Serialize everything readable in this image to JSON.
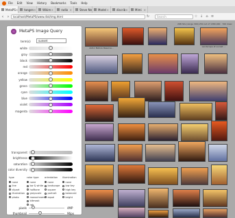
{
  "menubar": {
    "items": [
      "File",
      "Edit",
      "View",
      "History",
      "Bookmarks",
      "Tools",
      "Help"
    ]
  },
  "tabs": [
    {
      "label": "MetaPS",
      "active": true
    },
    {
      "label": "tangen",
      "active": false
    },
    {
      "label": "Wikim",
      "active": false
    },
    {
      "label": "radio",
      "active": false
    },
    {
      "label": "Steve Net",
      "active": false
    },
    {
      "label": "Model",
      "active": false
    },
    {
      "label": "discrib",
      "active": false
    },
    {
      "label": "Mimi",
      "active": false
    }
  ],
  "urlbar": {
    "url": "localhost/MetaPS/www.dist/img.html",
    "search_placeholder": "Search"
  },
  "info_text": "268 hits (range 300) 250 out of 1380,000 · 700 msec",
  "panel": {
    "title_main": "MetaPS",
    "title_sub": " Image Query",
    "term_label": "term(s)",
    "term_value": "sunset",
    "sliders": [
      {
        "label": "white",
        "gradient": "linear-gradient(90deg,#ddd,#fff)",
        "knob": 0.5
      },
      {
        "label": "gray",
        "gradient": "linear-gradient(90deg,#ddd,#777)",
        "knob": 0.5
      },
      {
        "label": "black",
        "gradient": "linear-gradient(90deg,#ddd,#000)",
        "knob": 0.5
      },
      {
        "label": "red",
        "gradient": "linear-gradient(90deg,#ddd,#f00)",
        "knob": 0.5
      },
      {
        "label": "orange",
        "gradient": "linear-gradient(90deg,#ddd,#ff8c00)",
        "knob": 0.5
      },
      {
        "label": "yellow",
        "gradient": "linear-gradient(90deg,#ddd,#ff0)",
        "knob": 0.5
      },
      {
        "label": "green",
        "gradient": "linear-gradient(90deg,#ddd,#0f0)",
        "knob": 0.5
      },
      {
        "label": "cyan",
        "gradient": "linear-gradient(90deg,#ddd,#0ff)",
        "knob": 0.5
      },
      {
        "label": "blue",
        "gradient": "linear-gradient(90deg,#ddd,#00f)",
        "knob": 0.5
      },
      {
        "label": "violet",
        "gradient": "linear-gradient(90deg,#ddd,#a0f)",
        "knob": 0.5
      },
      {
        "label": "magenta",
        "gradient": "linear-gradient(90deg,#ddd,#f0f)",
        "knob": 0.5
      },
      {
        "label": "transparent",
        "gradient": "linear-gradient(90deg,#ddd,#bbb)",
        "knob": 0.05
      },
      {
        "label": "brightness",
        "gradient": "linear-gradient(90deg,#000,#fff)",
        "knob": 0.05
      },
      {
        "label": "saturation",
        "gradient": "linear-gradient(90deg,#ddd,#000)",
        "knob": 0.05
      },
      {
        "label": "color diversity",
        "gradient": "linear-gradient(90deg,#ddd,#000)",
        "knob": 0.05
      }
    ],
    "options": [
      {
        "head": "type",
        "items": [
          {
            "t": "none",
            "on": true
          },
          {
            "t": "line",
            "on": false
          },
          {
            "t": "clipart",
            "on": false
          },
          {
            "t": "illustration",
            "on": false
          },
          {
            "t": "photo",
            "on": false
          }
        ]
      },
      {
        "head": "color type",
        "items": [
          {
            "t": "none",
            "on": true
          },
          {
            "t": "bw & white",
            "on": false
          },
          {
            "t": "halftone",
            "on": false
          },
          {
            "t": "grayscale",
            "on": false
          },
          {
            "t": "monochrome",
            "on": false
          },
          {
            "t": "bitmask",
            "on": false
          },
          {
            "t": "rgb",
            "on": false
          }
        ]
      },
      {
        "head": "orientation",
        "items": [
          {
            "t": "none",
            "on": true
          },
          {
            "t": "landscape",
            "on": false
          },
          {
            "t": "square",
            "on": false
          },
          {
            "t": "portrait",
            "on": false
          },
          {
            "t": "equal",
            "on": false
          }
        ]
      },
      {
        "head": "illumination",
        "items": [
          {
            "t": "none",
            "on": true
          },
          {
            "t": "low key",
            "on": false
          },
          {
            "t": "high key",
            "on": false
          },
          {
            "t": "balanced",
            "on": false
          },
          {
            "t": "bright",
            "on": false
          }
        ]
      }
    ],
    "pixels_label": "pixels",
    "pixels_value": "4MP",
    "thumbnail_label": "thumbnail",
    "thumbnail_value": "96px"
  },
  "thumbs": [
    {
      "caption": "Aston Nature Reserve...",
      "c1": "#f6c87a",
      "c2": "#704030"
    },
    {
      "caption": "",
      "c1": "#e05a2a",
      "c2": "#3a1010"
    },
    {
      "caption": "",
      "c1": "#f0b070",
      "c2": "#2a2a60"
    },
    {
      "caption": "",
      "c1": "#f4c44c",
      "c2": "#553311"
    },
    {
      "caption": "Landscape at sunset ...",
      "c1": "#f3a45c",
      "c2": "#4b3a5a"
    },
    {
      "caption": "",
      "c1": "#d8d0e0",
      "c2": "#505a80"
    },
    {
      "caption": "",
      "c1": "#f5a040",
      "c2": "#3a2a20"
    },
    {
      "caption": "",
      "c1": "#e8904a",
      "c2": "#6a3a6a"
    },
    {
      "caption": "",
      "c1": "#c0a8d8",
      "c2": "#3a2a50"
    },
    {
      "caption": "",
      "c1": "#f0c080",
      "c2": "#4a3040"
    },
    {
      "caption": "",
      "c1": "#e89050",
      "c2": "#2a1a1a"
    },
    {
      "caption": "",
      "c1": "#f0a030",
      "c2": "#503020"
    },
    {
      "caption": "",
      "c1": "#e0a070",
      "c2": "#302020"
    },
    {
      "caption": "",
      "c1": "#d05030",
      "c2": "#401010"
    },
    {
      "caption": "",
      "c1": "#f0b880",
      "c2": "#404070"
    },
    {
      "caption": "",
      "c1": "#e06a3a",
      "c2": "#2a1a1a"
    },
    {
      "caption": "",
      "c1": "#f2a838",
      "c2": "#3a2414"
    },
    {
      "caption": "",
      "c1": "#8a94b8",
      "c2": "#2a3050"
    },
    {
      "caption": "",
      "c1": "#f0c060",
      "c2": "#604020"
    },
    {
      "caption": "",
      "c1": "#d85a3a",
      "c2": "#301818"
    },
    {
      "caption": "",
      "c1": "#c8a8d0",
      "c2": "#403050"
    },
    {
      "caption": "",
      "c1": "#f09040",
      "c2": "#402010"
    },
    {
      "caption": "",
      "c1": "#e8b070",
      "c2": "#2a2030"
    },
    {
      "caption": "",
      "c1": "#f6d070",
      "c2": "#705030"
    },
    {
      "caption": "",
      "c1": "#e85a20",
      "c2": "#501810"
    },
    {
      "caption": "",
      "c1": "#b0b8d8",
      "c2": "#303858"
    },
    {
      "caption": "",
      "c1": "#f4a050",
      "c2": "#503030"
    },
    {
      "caption": "",
      "c1": "#e8c090",
      "c2": "#404050"
    },
    {
      "caption": "",
      "c1": "#f0a860",
      "c2": "#301a10"
    },
    {
      "caption": "",
      "c1": "#d0d8e8",
      "c2": "#6070a0"
    },
    {
      "caption": "",
      "c1": "#f3b050",
      "c2": "#5a3a20"
    },
    {
      "caption": "",
      "c1": "#e07a3a",
      "c2": "#301810"
    },
    {
      "caption": "",
      "c1": "#f7c050",
      "c2": "#805020"
    },
    {
      "caption": "",
      "c1": "#f0a050",
      "c2": "#503a3a"
    },
    {
      "caption": "",
      "c1": "#f8d878",
      "c2": "#a06030"
    },
    {
      "caption": "",
      "c1": "#f0904a",
      "c2": "#281818"
    },
    {
      "caption": "",
      "c1": "#c0b0d0",
      "c2": "#404060"
    },
    {
      "caption": "",
      "c1": "#f1b870",
      "c2": "#4a3020"
    },
    {
      "caption": "",
      "c1": "#e0804a",
      "c2": "#201010"
    },
    {
      "caption": "",
      "c1": "#f4c468",
      "c2": "#603820"
    },
    {
      "caption": "",
      "c1": "#d8b0c0",
      "c2": "#504060"
    },
    {
      "caption": "",
      "c1": "#f0a040",
      "c2": "#301c10"
    },
    {
      "caption": "",
      "c1": "#9aa8c8",
      "c2": "#28304a"
    },
    {
      "caption": "",
      "c1": "#e8a060",
      "c2": "#503030"
    }
  ]
}
